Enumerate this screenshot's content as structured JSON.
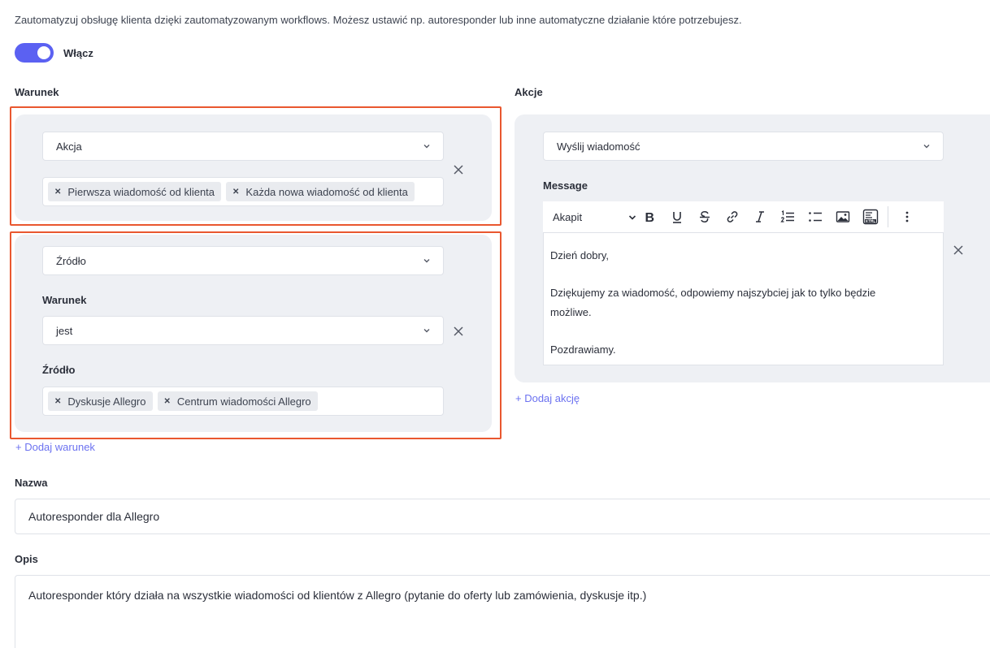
{
  "intro": "Zautomatyzuj obsługę klienta dzięki zautomatyzowanym workflows. Możesz ustawić np. autoresponder lub inne automatyczne działanie które potrzebujesz.",
  "toggle": {
    "label": "Włącz",
    "enabled": true,
    "color": "#5b61f2"
  },
  "conditions": {
    "heading": "Warunek",
    "blocks": [
      {
        "select": "Akcja",
        "tags": [
          "Pierwsza wiadomość od klienta",
          "Każda nowa wiadomość od klienta"
        ]
      },
      {
        "select": "Źródło",
        "condition_label": "Warunek",
        "condition_value": "jest",
        "source_label": "Źródło",
        "tags": [
          "Dyskusje Allegro",
          "Centrum wiadomości Allegro"
        ]
      }
    ],
    "add_link": "+ Dodaj warunek",
    "highlight_color": "#e9572f"
  },
  "actions": {
    "heading": "Akcje",
    "select": "Wyślij wiadomość",
    "message_label": "Message",
    "toolbar": {
      "format": "Akapit",
      "buttons": [
        "bold-icon",
        "underline-icon",
        "strikethrough-icon",
        "link-icon",
        "italic-icon",
        "numbered-list-icon",
        "bulleted-list-icon",
        "image-icon",
        "html-icon",
        "more-icon"
      ]
    },
    "message": {
      "line1": "Dzień dobry,",
      "line2": "Dziękujemy za wiadomość, odpowiemy najszybciej jak to tylko będzie możliwe.",
      "line3": "Pozdrawiamy."
    },
    "add_link": "+ Dodaj akcję"
  },
  "name": {
    "label": "Nazwa",
    "value": "Autoresponder dla Allegro"
  },
  "description": {
    "label": "Opis",
    "value": "Autoresponder który działa na wszystkie wiadomości od klientów z Allegro (pytanie do oferty lub zamówienia, dyskusje itp.)"
  }
}
